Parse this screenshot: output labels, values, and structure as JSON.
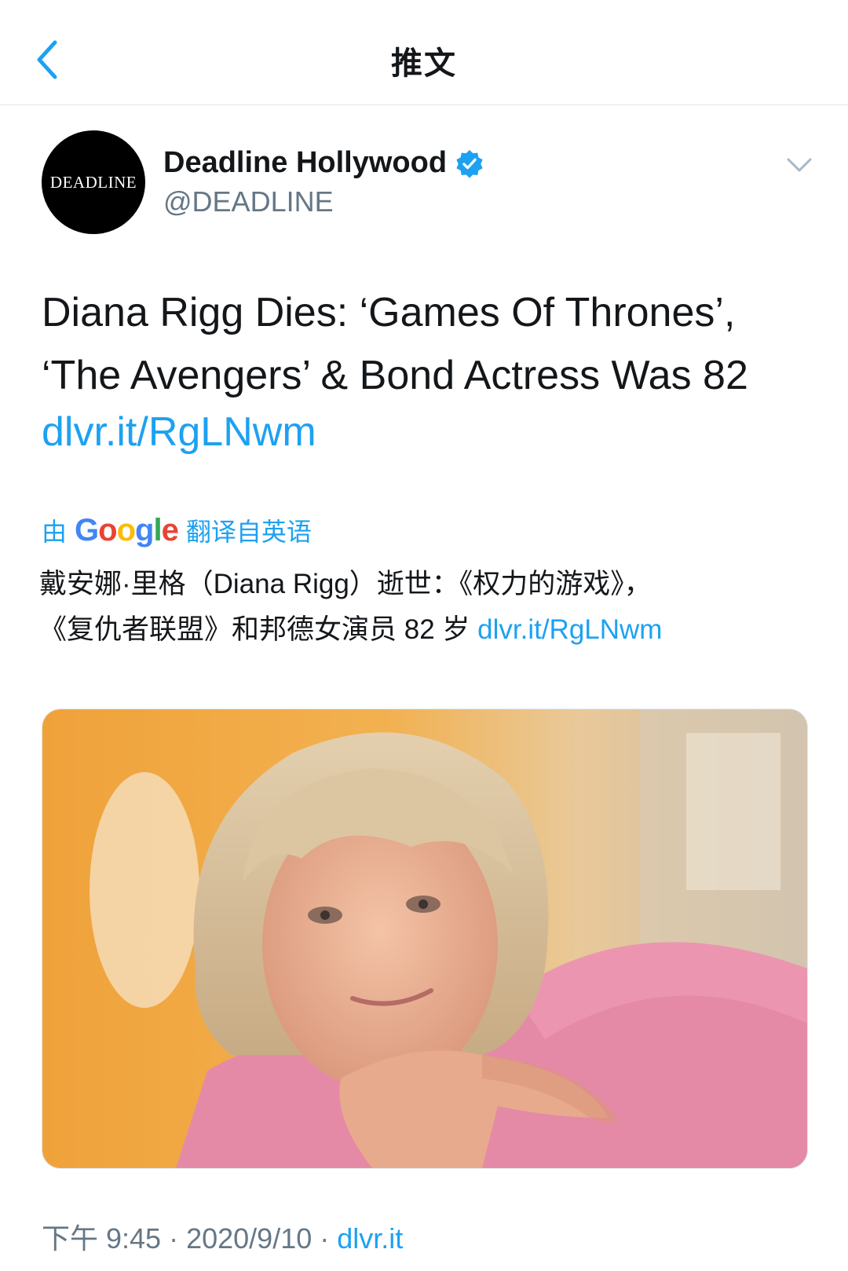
{
  "nav": {
    "title": "推文"
  },
  "author": {
    "avatar_text": "DEADLINE",
    "display_name": "Deadline Hollywood",
    "handle": "@DEADLINE"
  },
  "tweet": {
    "line1": "Diana Rigg Dies: ‘Games Of Thrones’,",
    "line2": "‘The Avengers’ & Bond Actress Was 82",
    "link": "dlvr.it/RgLNwm"
  },
  "translation": {
    "prefix": "由",
    "provider": "Google",
    "suffix": "翻译自英语",
    "text_line1": "戴安娜·里格（Diana Rigg）逝世：《权力的游戏》，",
    "text_line2": "《复仇者联盟》和邦德女演员 82 岁",
    "link": "dlvr.it/RgLNwm"
  },
  "meta": {
    "time": "下午 9:45",
    "sep1": " · ",
    "date": "2020/9/10",
    "sep2": " · ",
    "source": "dlvr.it"
  },
  "colors": {
    "accent": "#1da1f2",
    "secondary_text": "#657786",
    "divider": "#e1e8ed"
  },
  "icons": [
    "back-chevron-icon",
    "verified-badge-icon",
    "caret-down-icon"
  ]
}
